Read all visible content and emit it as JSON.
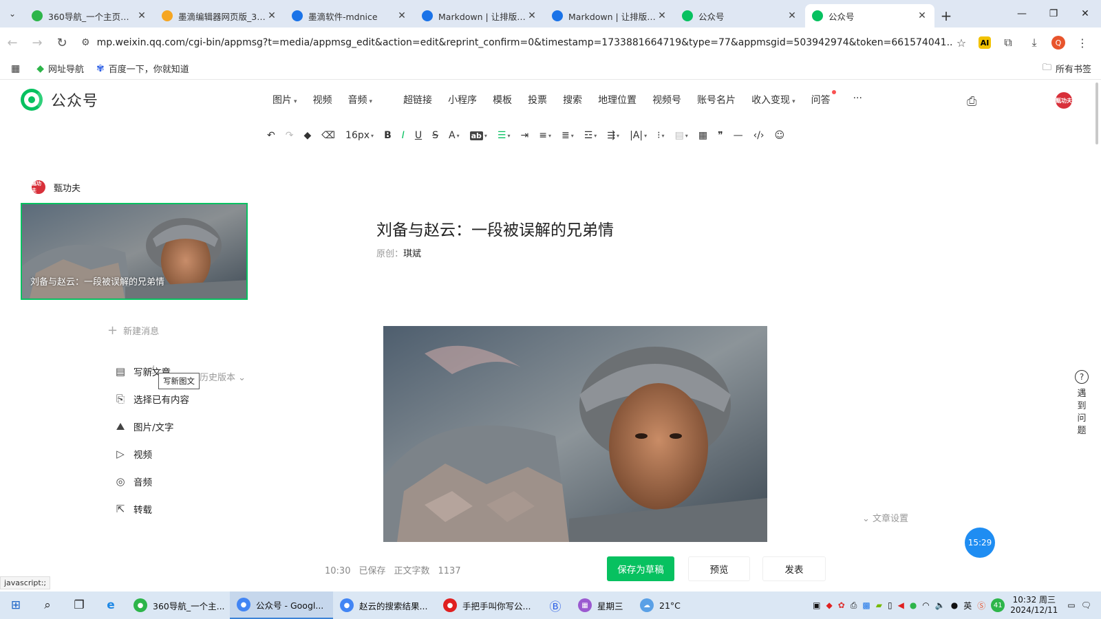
{
  "browser": {
    "tabs": [
      {
        "title": "360导航_一个主页，整个世界",
        "icon": "360-icon",
        "color": "#2db54a"
      },
      {
        "title": "墨滴编辑器网页版_360搜索",
        "icon": "search-icon",
        "color": "#f5a623"
      },
      {
        "title": "墨滴软件-mdnice",
        "icon": "mdnice-icon",
        "color": "#1a73e8"
      },
      {
        "title": "Markdown | 让排版变 Nice",
        "icon": "mdnice-icon",
        "color": "#1a73e8"
      },
      {
        "title": "Markdown | 让排版变 Nice",
        "icon": "mdnice-icon",
        "color": "#1a73e8"
      },
      {
        "title": "公众号",
        "icon": "wechat-mp-icon",
        "color": "#07c160"
      },
      {
        "title": "公众号",
        "icon": "wechat-mp-icon",
        "color": "#07c160",
        "active": true
      }
    ],
    "url": "mp.weixin.qq.com/cgi-bin/appmsg?t=media/appmsg_edit&action=edit&reprint_confirm=0&timestamp=1733881664719&type=77&appmsgid=503942974&token=661574041...",
    "profile_letter": "Q",
    "bookmarks": [
      "网址导航",
      "百度一下，你就知道"
    ],
    "all_bookmarks": "所有书签"
  },
  "editor": {
    "logo_text": "公众号",
    "insert_menu": [
      "图片",
      "视频",
      "音频",
      "超链接",
      "小程序",
      "模板",
      "投票",
      "搜索",
      "地理位置",
      "视频号",
      "账号名片",
      "收入变现",
      "问答"
    ],
    "more": "···",
    "font_size": "16px",
    "avatar_text": "甄功夫"
  },
  "sidebar": {
    "account_name": "甄功夫",
    "cover_caption": "刘备与赵云：一段被误解的兄弟情",
    "new_message": "新建消息",
    "menu": [
      {
        "label": "写新文章",
        "icon": "document-icon"
      },
      {
        "label": "选择已有内容",
        "icon": "content-select-icon"
      },
      {
        "label": "图片/文字",
        "icon": "image-icon"
      },
      {
        "label": "视频",
        "icon": "video-icon"
      },
      {
        "label": "音频",
        "icon": "audio-icon"
      },
      {
        "label": "转载",
        "icon": "repost-icon"
      }
    ],
    "history": "历史版本",
    "tooltip": "写新图文"
  },
  "article": {
    "title": "刘备与赵云：一段被误解的兄弟情",
    "byline_label": "原创：",
    "author": "琪斌",
    "settings": "文章设置"
  },
  "bottom": {
    "save_time": "10:30",
    "saved": "已保存",
    "word_count_label": "正文字数",
    "word_count": "1137",
    "save_draft": "保存为草稿",
    "preview": "预览",
    "publish": "发表"
  },
  "timer": "15:29",
  "help": "遇到问题",
  "status_url": "javascript:;",
  "taskbar": {
    "apps": [
      {
        "label": "360导航_一个主...",
        "color": "#2db54a"
      },
      {
        "label": "公众号 - Googl...",
        "color": "#4285f4",
        "active": true
      },
      {
        "label": "赵云的搜索结果...",
        "color": "#4285f4"
      },
      {
        "label": "手把手叫你写公...",
        "color": "#e02020"
      }
    ],
    "calendar": "星期三",
    "weather": "21°C",
    "ime": "英",
    "notify_count": "41",
    "time": "10:32 周三",
    "date": "2024/12/11"
  }
}
